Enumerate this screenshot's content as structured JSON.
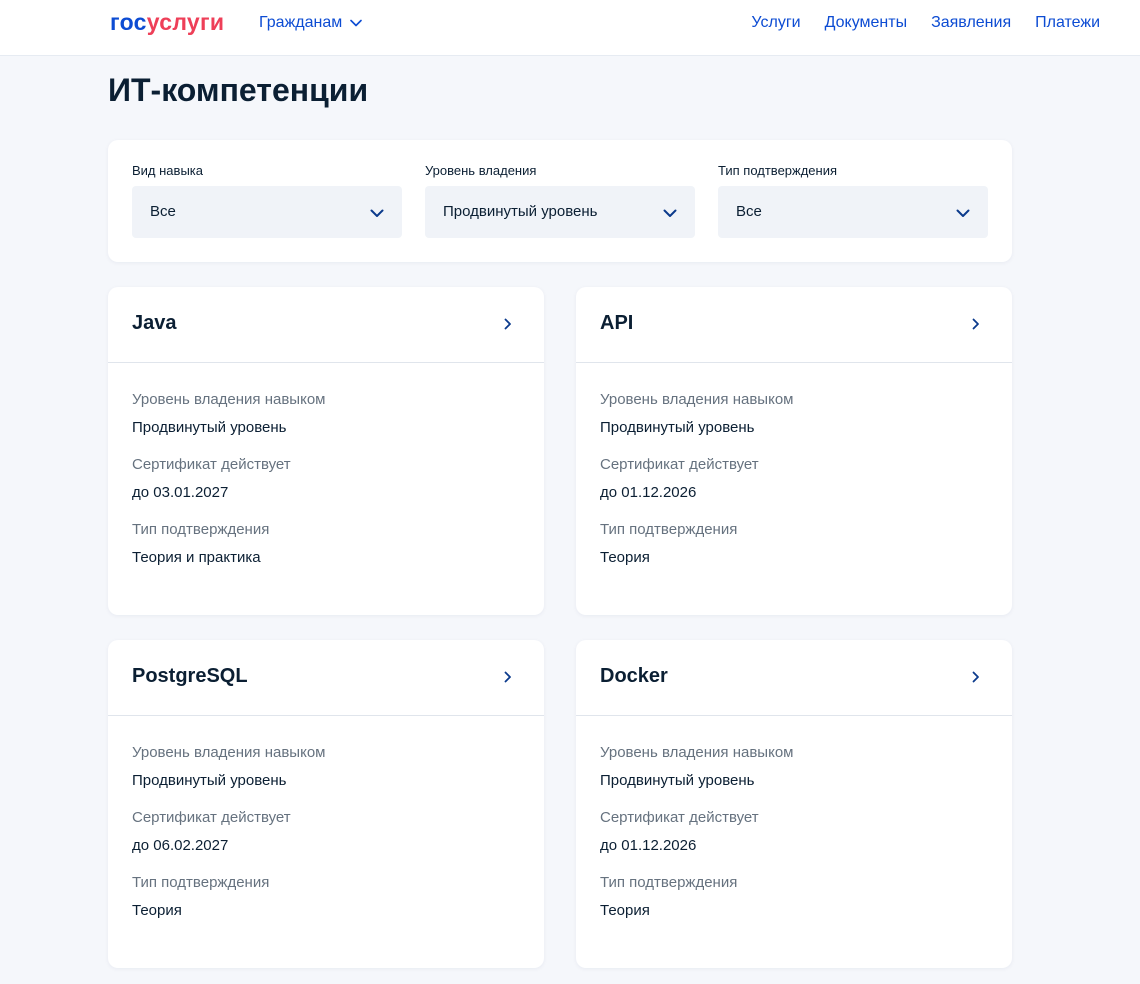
{
  "header": {
    "logo": {
      "part1": "гос",
      "part2": "услуги"
    },
    "audience": "Гражданам",
    "nav": [
      "Услуги",
      "Документы",
      "Заявления",
      "Платежи"
    ]
  },
  "page": {
    "title": "ИТ-компетенции"
  },
  "filters": [
    {
      "label": "Вид навыка",
      "value": "Все"
    },
    {
      "label": "Уровень владения",
      "value": "Продвинутый уровень"
    },
    {
      "label": "Тип подтверждения",
      "value": "Все"
    }
  ],
  "field_labels": {
    "level": "Уровень владения навыком",
    "cert": "Сертификат действует",
    "type": "Тип подтверждения"
  },
  "cards": [
    {
      "title": "Java",
      "level": "Продвинутый уровень",
      "cert": "до 03.01.2027",
      "type": "Теория и практика"
    },
    {
      "title": "API",
      "level": "Продвинутый уровень",
      "cert": "до 01.12.2026",
      "type": "Теория"
    },
    {
      "title": "PostgreSQL",
      "level": "Продвинутый уровень",
      "cert": "до 06.02.2027",
      "type": "Теория"
    },
    {
      "title": "Docker",
      "level": "Продвинутый уровень",
      "cert": "до 01.12.2026",
      "type": "Теория"
    }
  ],
  "colors": {
    "accent": "#0d4cd3",
    "logo_red": "#ee3f58",
    "text": "#0b1f33",
    "muted": "#66727f",
    "background": "#f5f7fb"
  }
}
